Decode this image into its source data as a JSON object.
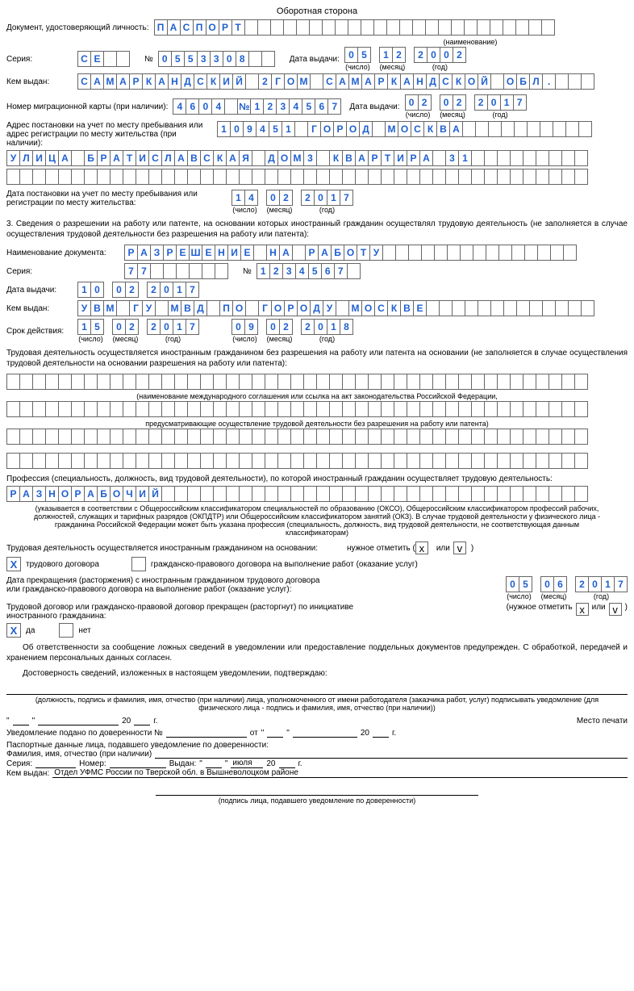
{
  "title": "Оборотная сторона",
  "doc_label": "Документ, удостоверяющий личность:",
  "doc_value": "ПАСПОРТ",
  "doc_sub": "(наименование)",
  "series_label": "Серия:",
  "series_value": "СЕ",
  "num_label": "№",
  "num_value": "0553308",
  "issue_date_label": "Дата выдачи:",
  "issue_day": "05",
  "issue_month": "12",
  "issue_year": "2002",
  "sub_day": "(число)",
  "sub_month": "(месяц)",
  "sub_year": "(год)",
  "issued_by_label": "Кем выдан:",
  "issued_by_value": "САМАРКАНДСКИЙ 2ГОМ САМАРКАНДСКОЙ ОБЛ.",
  "migr_label": "Номер миграционной карты (при наличии):",
  "migr_value": "4604 №1234567",
  "migr_date_label": "Дата выдачи:",
  "migr_day": "02",
  "migr_month": "02",
  "migr_year": "2017",
  "addr_label": "Адрес постановки на учет по месту пребывания или\nадрес регистрации по месту жительства (при наличии):",
  "addr_line1": "109451 ГОРОД МОСКВА",
  "addr_line2": "УЛИЦА БРАТИСЛАВСКАЯ ДОМ3 КВАРТИРА 31",
  "reg_date_label": "Дата постановки на учет по месту пребывания или\nрегистрации по месту жительства:",
  "reg_day": "14",
  "reg_month": "02",
  "reg_year": "2017",
  "section3": "3.  Сведения о разрешении на работу или патенте, на основании которых иностранный гражданин осуществлял трудовую деятельность (не заполняется в случае осуществления трудовой деятельности без разрешения на работу или патента):",
  "permit_name_label": "Наименование документа:",
  "permit_name_value": "РАЗРЕШЕНИЕ НА РАБОТУ",
  "permit_series_label": "Серия:",
  "permit_series_value": "77",
  "permit_num_label": "№",
  "permit_num_value": "1234567",
  "permit_date_label": "Дата выдачи:",
  "permit_day": "10",
  "permit_month": "02",
  "permit_year": "2017",
  "permit_by_label": "Кем выдан:",
  "permit_by_value": "УВМ ГУ МВД ПО ГОРОДУ МОСКВЕ",
  "validity_label": "Срок действия:",
  "val_d1": "15",
  "val_m1": "02",
  "val_y1": "2017",
  "val_d2": "09",
  "val_m2": "02",
  "val_y2": "2018",
  "para_basis": "Трудовая деятельность осуществляется иностранным гражданином без разрешения на работу или патента на основании (не заполняется в случае осуществления трудовой деятельности на основании разрешения на работу или патента):",
  "sub_agree": "(наименование международного соглашения или ссылка на акт законодательства Российской Федерации,",
  "sub_agree2": "предусматривающие осуществление трудовой деятельности без разрешения на работу или патента)",
  "prof_label": "Профессия (специальность, должность, вид трудовой деятельности), по которой иностранный гражданин осуществляет трудовую деятельность:",
  "prof_value": "РАЗНОРАБОЧИЙ",
  "prof_sub": "(указывается в соответствии с Общероссийским классификатором специальностей по образованию (ОКСО), Общероссийским классификатором профессий рабочих, должностей, служащих и тарифных разрядов (ОКПДТР) или Общероссийским классификатором занятий (ОКЗ). В случае трудовой деятельности у физического лица - гражданина Российской Федерации может быть указана профессия (специальность, должность, вид трудовой деятельности, не соответствующая данным классификаторам)",
  "basis_label": "Трудовая деятельность осуществляется иностранным гражданином на основании:",
  "mark_label": "нужное отметить (",
  "mark_x": "x",
  "mark_or": "или",
  "mark_v": "v",
  "mark_close": ")",
  "opt1": "трудового договора",
  "opt2": "гражданско-правового договора на выполнение работ (оказание услуг)",
  "check1": "Х",
  "term_label": "Дата прекращения (расторжения) с иностранным гражданином трудового договора\nили гражданско-правового договора на выполнение работ (оказание услуг):",
  "term_day": "05",
  "term_month": "06",
  "term_year": "2017",
  "init_label": "Трудовой договор или гражданско-правовой договор прекращен (расторгнут) по инициативе\nиностранного гражданина:",
  "yes": "да",
  "no": "нет",
  "init_mark": "(нужное отметить",
  "warn": "Об ответственности за сообщение ложных сведений в уведомлении или предоставление поддельных документов предупрежден. С обработкой, передачей и хранением персональных данных согласен.",
  "confirm": "Достоверность сведений, изложенных в настоящем уведомлении, подтверждаю:",
  "sig_sub": "(должность, подпись и фамилия, имя, отчество (при наличии) лица, уполномоченного от имени работодателя (заказчика работ, услуг) подписывать уведомление (для физического лица - подпись и фамилия, имя, отчество (при наличии))",
  "place_stamp": "Место печати",
  "date_tpl_20": "20",
  "date_tpl_g": "г.",
  "proxy_num": "Уведомление подано по доверенности №",
  "proxy_from": "от",
  "passport_proxy": "Паспортные данные лица, подавшего уведомление по доверенности:",
  "fio_label": "Фамилия, имя, отчество (при наличии)",
  "ser_lbl": "Серия:",
  "num_lbl": "Номер:",
  "issued_lbl": "Выдан:",
  "july": "июля",
  "issued_by_lbl": "Кем выдан:",
  "issued_by_proxy": "Отдел УФМС России по Тверской обл. в Вышневолоцком районе",
  "proxy_sig_sub": "(подпись лица, подавшего уведомление по доверенности)"
}
